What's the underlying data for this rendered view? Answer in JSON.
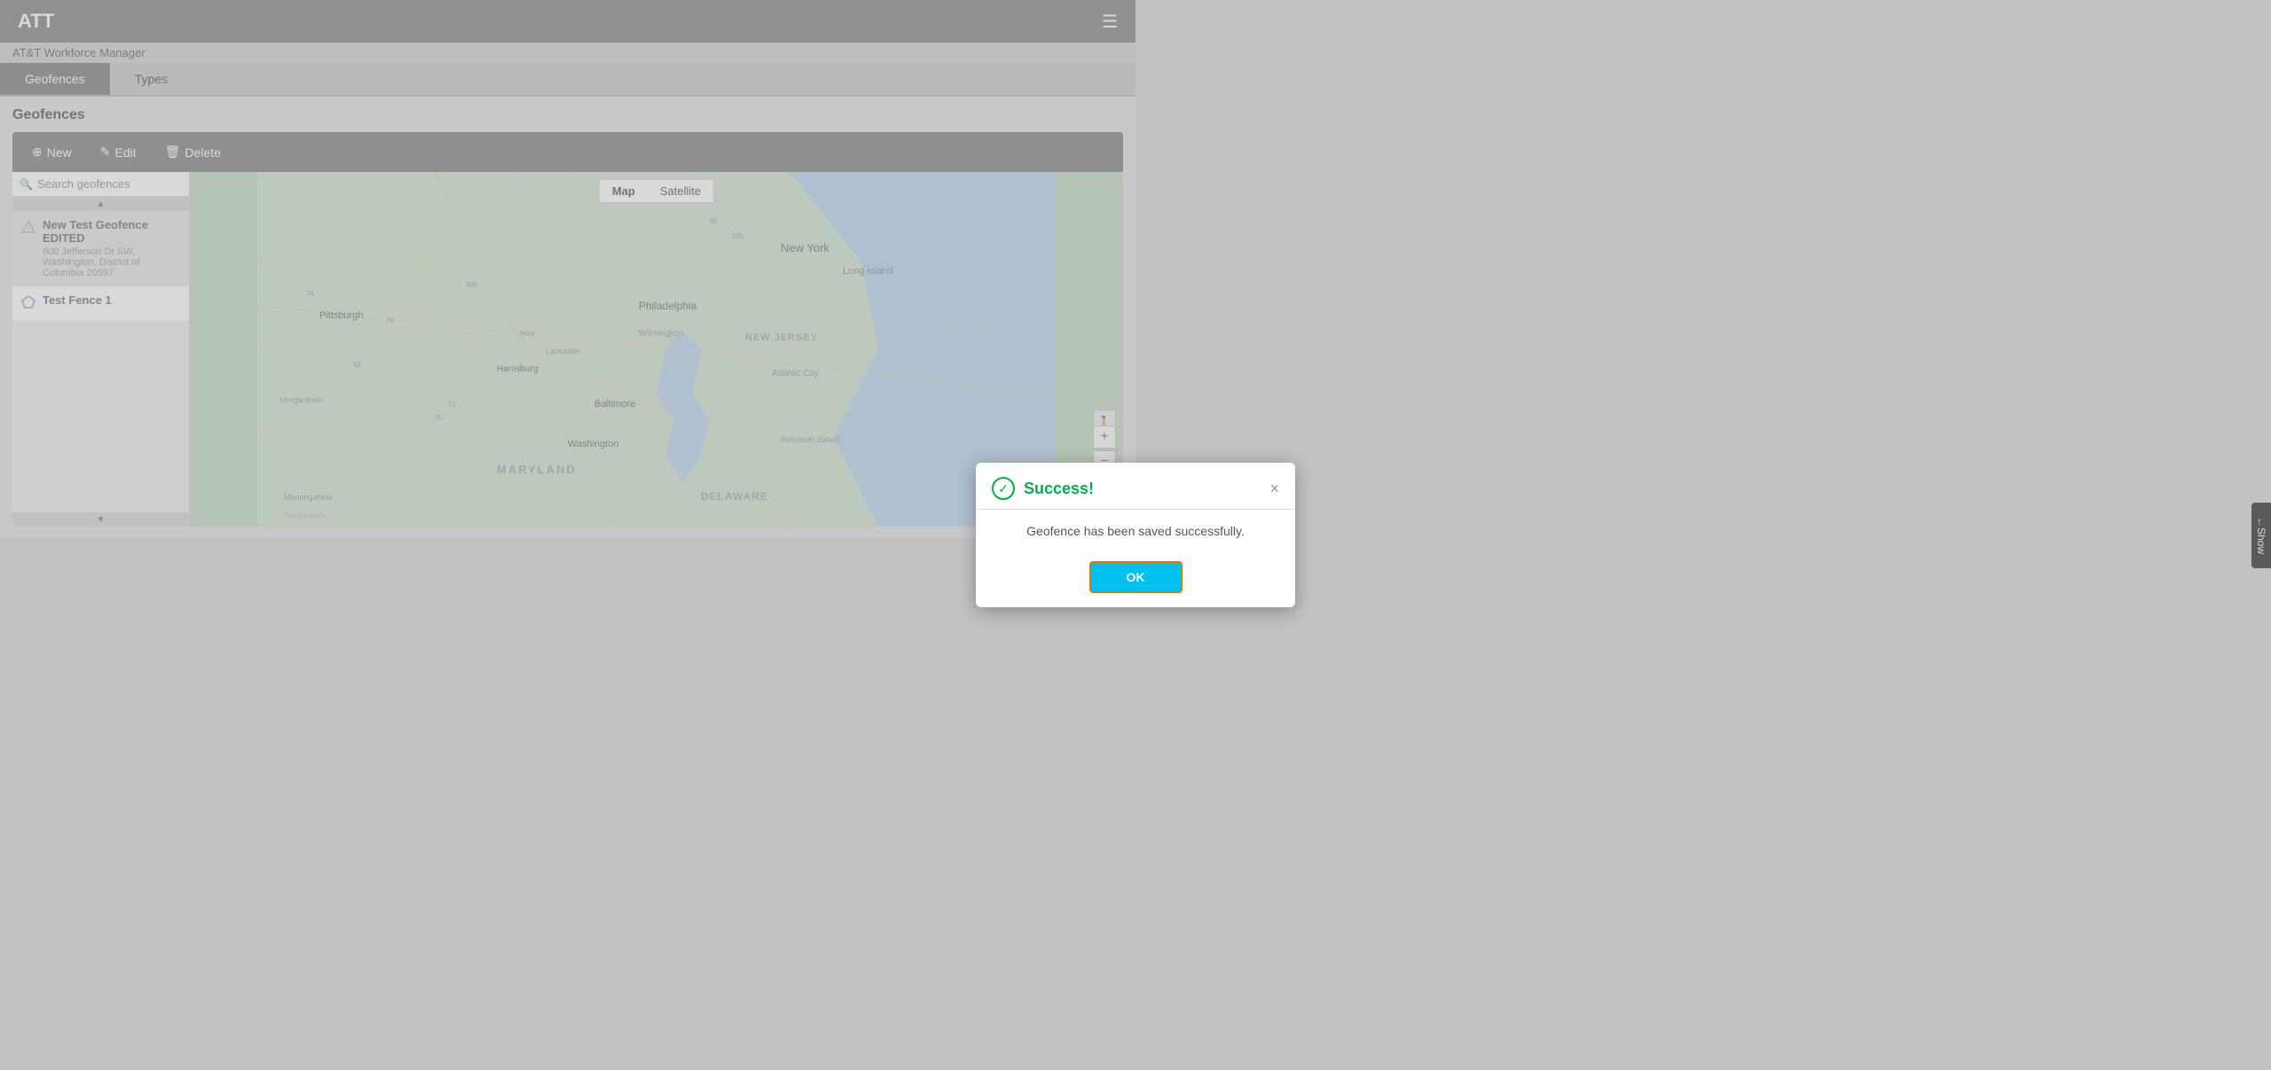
{
  "app": {
    "title": "ATT",
    "menu_icon": "☰"
  },
  "breadcrumb": "AT&T Workforce Manager",
  "tabs": [
    {
      "id": "geofences",
      "label": "Geofences",
      "active": true
    },
    {
      "id": "types",
      "label": "Types",
      "active": false
    }
  ],
  "section_title": "Geofences",
  "toolbar": {
    "new_label": "New",
    "edit_label": "Edit",
    "delete_label": "Delete"
  },
  "search": {
    "placeholder": "Search geofences"
  },
  "fence_list": [
    {
      "name": "New Test Geofence EDITED",
      "address": "600 Jefferson Dr SW, Washington, District of Columbia 20597",
      "icon": "warning"
    },
    {
      "name": "Test Fence 1",
      "address": "",
      "icon": "pentagon"
    }
  ],
  "map_tabs": [
    {
      "label": "Map",
      "active": true
    },
    {
      "label": "Satellite",
      "active": false
    }
  ],
  "map_cities": [
    "Pittsburgh",
    "Harrisburg",
    "Baltimore",
    "Washington",
    "Philadelphia",
    "Wilmington",
    "New York",
    "Long Island",
    "Atlantic City",
    "Morgantown",
    "Monongahela",
    "York",
    "Lancaster",
    "Rehoboth Beach",
    "MARYLAND",
    "NEW JERSEY",
    "DELAWARE"
  ],
  "dialog": {
    "title": "Success!",
    "message": "Geofence has been saved successfully.",
    "ok_label": "OK",
    "close_label": "×"
  },
  "show_panel": {
    "arrow": "←",
    "label": "Show"
  }
}
